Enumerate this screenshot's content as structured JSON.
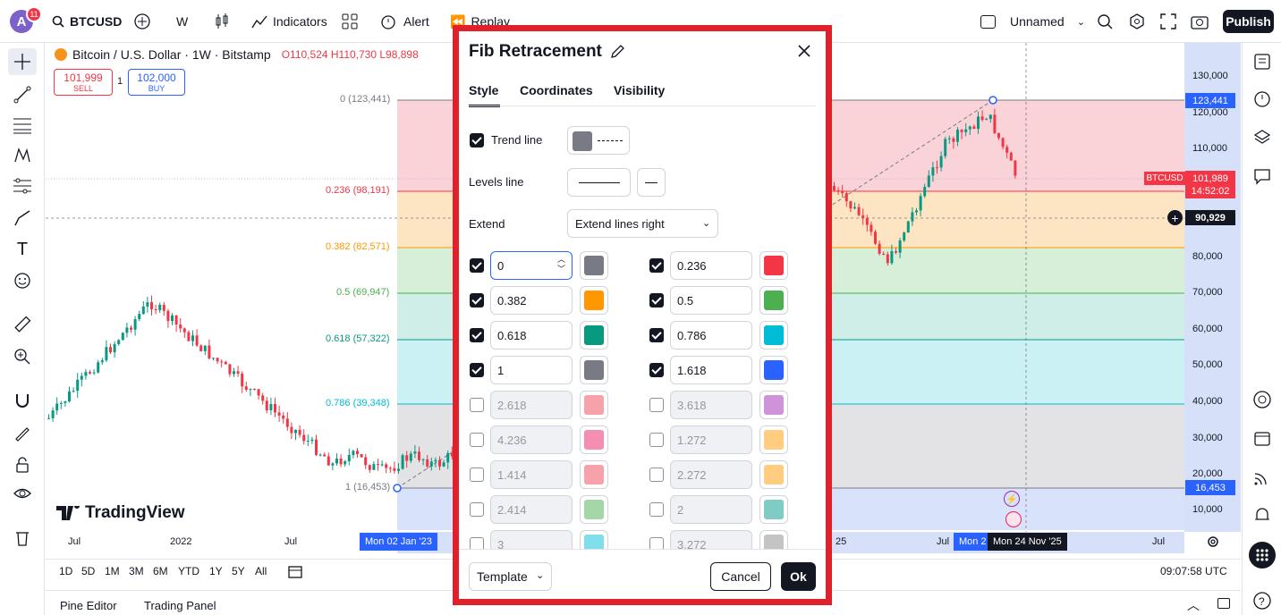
{
  "topbar": {
    "avatar_letter": "A",
    "notifications": "11",
    "symbol": "BTCUSD",
    "interval": "W",
    "indicators": "Indicators",
    "alert": "Alert",
    "replay": "Replay",
    "layout_name": "Unnamed",
    "publish": "Publish"
  },
  "header": {
    "instrument": "Bitcoin / U.S. Dollar · 1W · Bitstamp",
    "ohlc": "O110,524 H110,730 L98,898",
    "sell_price": "101,999",
    "sell_label": "SELL",
    "qty": "1",
    "buy_price": "102,000",
    "buy_label": "BUY"
  },
  "chart": {
    "price_ticks": [
      "130,000",
      "120,000",
      "110,000",
      "80,000",
      "70,000",
      "60,000",
      "50,000",
      "40,000",
      "30,000",
      "20,000",
      "10,000"
    ],
    "fib_labels": [
      "0 (123,441)",
      "0.236 (98,191)",
      "0.382 (82,571)",
      "0.5 (69,947)",
      "0.618 (57,322)",
      "0.786 (39,348)",
      "1 (16,453)"
    ],
    "price_markers": {
      "top": "123,441",
      "symbol": "BTCUSD",
      "last": "101,989",
      "countdown": "14:52:02",
      "crosshair": "90,929",
      "bottom": "16,453"
    },
    "time_labels": [
      "Jul",
      "2022",
      "Jul",
      "25",
      "Jul",
      "Jul"
    ],
    "time_markers": {
      "start": "Mon 02 Jan '23",
      "end_partial": "Mon 2",
      "end": "Mon 24 Nov '25"
    },
    "watermark": "TradingView",
    "colors": {
      "level_0": "#787b86",
      "level_0236": "#f23645",
      "level_0382": "#ff9800",
      "level_05": "#4caf50",
      "level_0618": "#089981",
      "level_0786": "#00bcd4",
      "level_1": "#787b86"
    }
  },
  "periods": {
    "items": [
      "1D",
      "5D",
      "1M",
      "3M",
      "6M",
      "YTD",
      "1Y",
      "5Y",
      "All"
    ],
    "clock": "09:07:58 UTC"
  },
  "bottom": {
    "pine": "Pine Editor",
    "trading": "Trading Panel"
  },
  "dialog": {
    "title": "Fib Retracement",
    "tabs": [
      "Style",
      "Coordinates",
      "Visibility"
    ],
    "trend_line_label": "Trend line",
    "levels_line_label": "Levels line",
    "extend_label": "Extend",
    "extend_value": "Extend lines right",
    "levels": [
      {
        "value": "0",
        "checked": true,
        "color": "#787b86"
      },
      {
        "value": "0.236",
        "checked": true,
        "color": "#f23645"
      },
      {
        "value": "0.382",
        "checked": true,
        "color": "#ff9800"
      },
      {
        "value": "0.5",
        "checked": true,
        "color": "#4caf50"
      },
      {
        "value": "0.618",
        "checked": true,
        "color": "#089981"
      },
      {
        "value": "0.786",
        "checked": true,
        "color": "#00bcd4"
      },
      {
        "value": "1",
        "checked": true,
        "color": "#787b86"
      },
      {
        "value": "1.618",
        "checked": true,
        "color": "#2962ff"
      },
      {
        "value": "2.618",
        "checked": false,
        "color": "#f7a1ab"
      },
      {
        "value": "3.618",
        "checked": false,
        "color": "#ce93d8"
      },
      {
        "value": "4.236",
        "checked": false,
        "color": "#f48fb1"
      },
      {
        "value": "1.272",
        "checked": false,
        "color": "#ffcc80"
      },
      {
        "value": "1.414",
        "checked": false,
        "color": "#f7a1ab"
      },
      {
        "value": "2.272",
        "checked": false,
        "color": "#ffcc80"
      },
      {
        "value": "2.414",
        "checked": false,
        "color": "#a5d6a7"
      },
      {
        "value": "2",
        "checked": false,
        "color": "#80cbc4"
      },
      {
        "value": "3",
        "checked": false,
        "color": "#80deea"
      },
      {
        "value": "3.272",
        "checked": false,
        "color": "#c4c4c4"
      }
    ],
    "template": "Template",
    "cancel": "Cancel",
    "ok": "Ok"
  }
}
